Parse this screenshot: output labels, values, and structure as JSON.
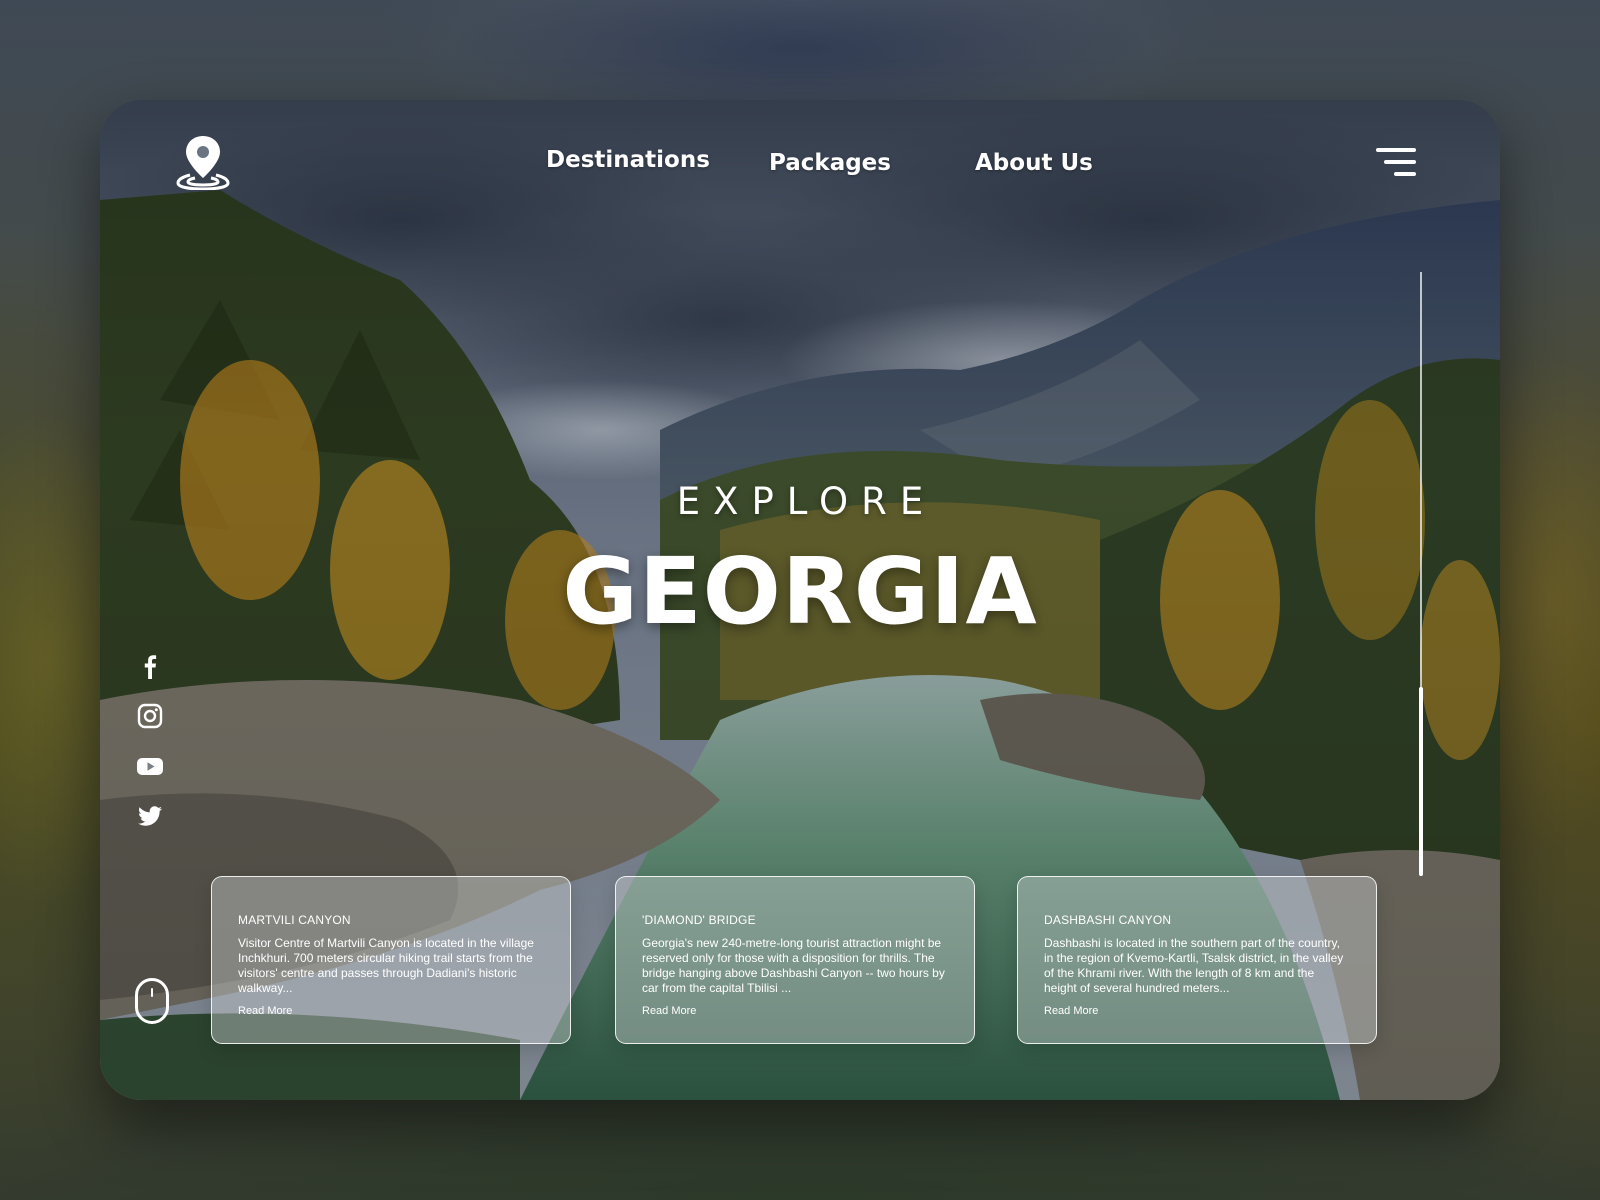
{
  "brand": {
    "logo_icon": "map-pin-icon"
  },
  "nav": {
    "items": [
      {
        "label": "Destinations"
      },
      {
        "label": "Packages"
      },
      {
        "label": "About Us"
      }
    ],
    "menu_icon": "hamburger-menu-icon"
  },
  "hero": {
    "kicker": "EXPLORE",
    "title": "GEORGIA"
  },
  "social": [
    "facebook-icon",
    "instagram-icon",
    "youtube-icon",
    "twitter-icon"
  ],
  "scroll_indicator_icon": "mouse-scroll-icon",
  "cards": [
    {
      "title": "MARTVILI CANYON",
      "body": "Visitor Centre of Martvili Canyon is located in the village Inchkhuri. 700 meters circular hiking trail starts from the visitors' centre and passes through Dadiani's historic walkway...",
      "link": "Read More"
    },
    {
      "title": "'DIAMOND' BRIDGE",
      "body": "Georgia's new 240-metre-long tourist attraction might be reserved only for those with a disposition for thrills. The bridge hanging above Dashbashi Canyon -- two hours by car from the capital Tbilisi ...",
      "link": "Read More"
    },
    {
      "title": "DASHBASHI CANYON",
      "body": "Dashbashi is located in the southern part of the country, in the region of Kvemo-Kartli, Tsalsk district, in the valley of the Khrami river. With the length of 8 km and the height of several hundred meters...",
      "link": "Read More"
    }
  ],
  "colors": {
    "text": "#ffffff",
    "card_background": "rgba(205,210,212,0.42)",
    "sky": "#5d6878",
    "mountain": "#3c4a63",
    "forest_dark": "#2b3a22",
    "forest_gold": "#b8861f",
    "river": "#4e7a5d",
    "rock": "#6e6a60"
  }
}
